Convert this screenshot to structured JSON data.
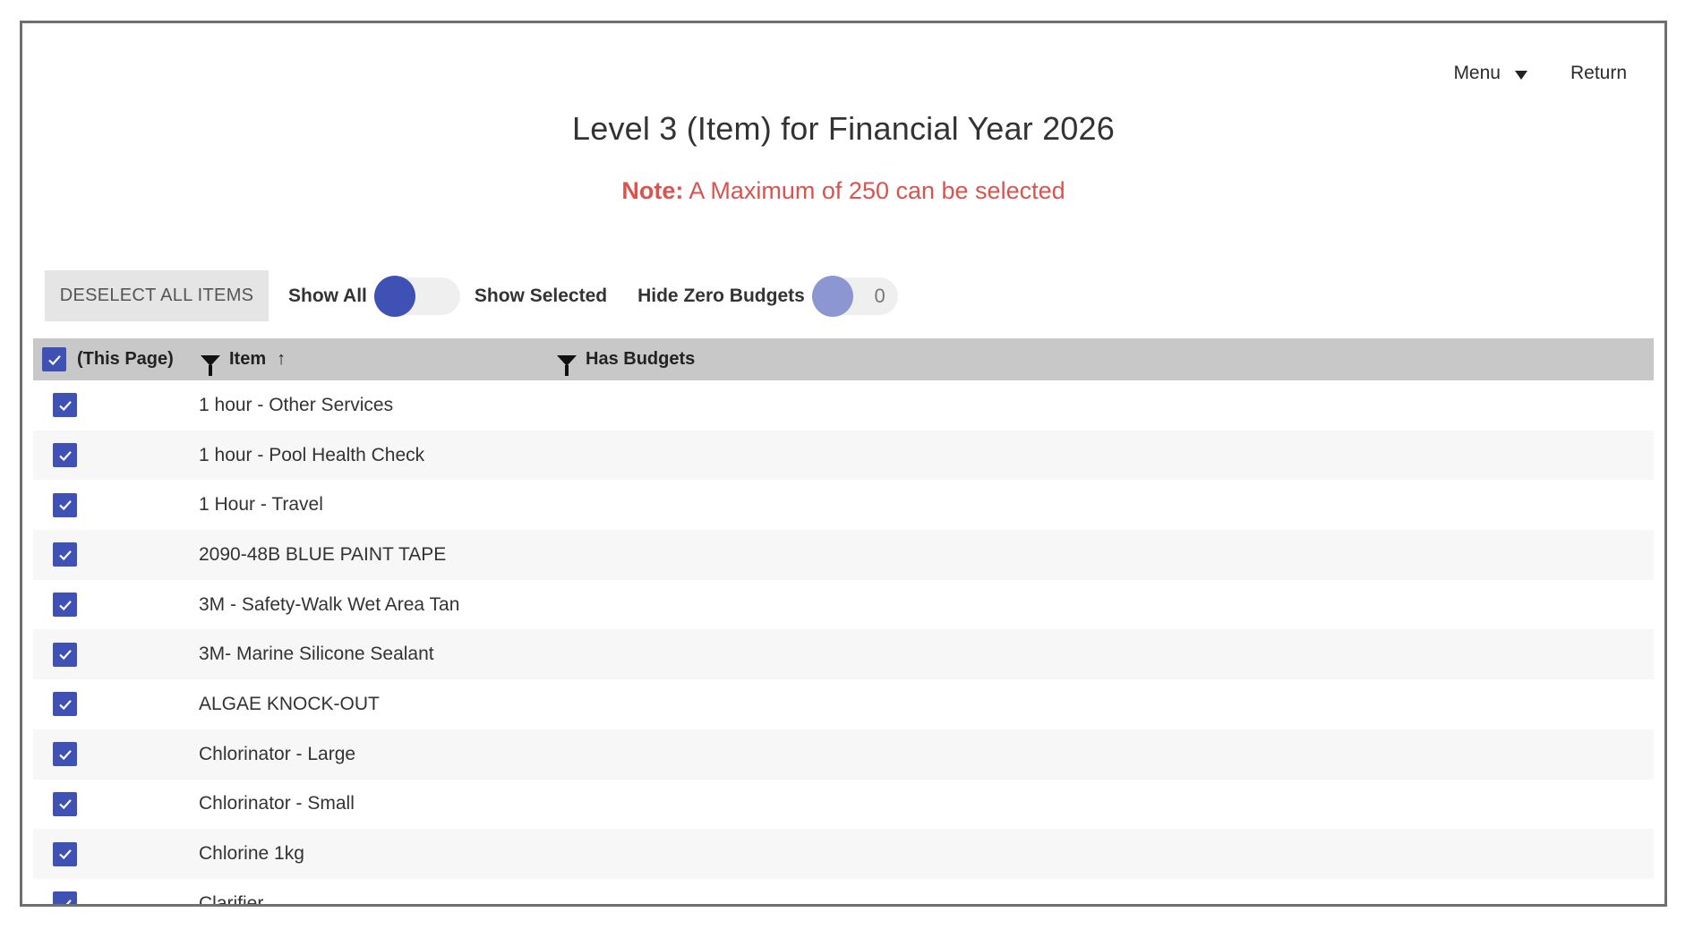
{
  "nav": {
    "menu_label": "Menu",
    "return_label": "Return"
  },
  "page": {
    "title": "Level 3 (Item) for Financial Year 2026",
    "note_label": "Note:",
    "note_text": " A Maximum of 250 can be selected"
  },
  "toolbar": {
    "deselect_label": "DESELECT ALL ITEMS",
    "show_all_label": "Show All",
    "show_selected_label": "Show Selected",
    "hide_zero_label": "Hide Zero Budgets",
    "hide_zero_count": "0"
  },
  "table": {
    "select_page_label": "(This Page)",
    "col_item": "Item",
    "col_item_sort": "↑",
    "col_has_budgets": "Has Budgets",
    "rows": [
      {
        "item": "1 hour - Other Services",
        "checked": true
      },
      {
        "item": "1 hour - Pool Health Check",
        "checked": true
      },
      {
        "item": "1 Hour - Travel",
        "checked": true
      },
      {
        "item": "2090-48B BLUE PAINT TAPE",
        "checked": true
      },
      {
        "item": "3M - Safety-Walk Wet Area Tan",
        "checked": true
      },
      {
        "item": "3M- Marine Silicone Sealant",
        "checked": true
      },
      {
        "item": "ALGAE KNOCK-OUT",
        "checked": true
      },
      {
        "item": "Chlorinator - Large",
        "checked": true
      },
      {
        "item": "Chlorinator - Small",
        "checked": true
      },
      {
        "item": "Chlorine 1kg",
        "checked": true
      },
      {
        "item": "Clarifier",
        "checked": true
      }
    ]
  },
  "colors": {
    "accent": "#3f51b5",
    "accent_dim": "#8c96d0",
    "note": "#d9534f",
    "header_bg": "#c8c8c8"
  }
}
